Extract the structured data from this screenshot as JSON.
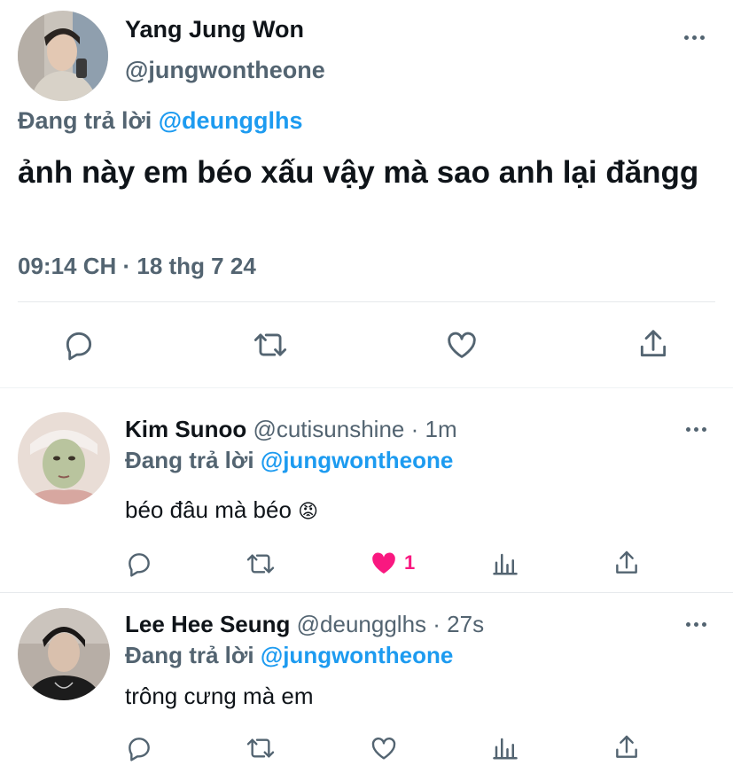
{
  "main_tweet": {
    "author_name": "Yang Jung Won",
    "author_handle": "@jungwontheone",
    "reply_prefix": "Đang trả lời",
    "reply_to": "@deungglhs",
    "text": "ảnh này em béo xấu vậy mà sao anh lại đăngg",
    "timestamp": "09:14 CH · 18 thg 7 24",
    "actions": [
      "reply-icon",
      "retweet-icon",
      "like-icon",
      "share-icon"
    ]
  },
  "replies": [
    {
      "author_name": "Kim Sunoo",
      "author_handle": "@cutisunshine",
      "time": "· 1m",
      "reply_prefix": "Đang trả lời",
      "reply_to": "@jungwontheone",
      "text": "béo đâu mà béo",
      "emoji": "😡",
      "like_count": "1",
      "liked": true
    },
    {
      "author_name": "Lee Hee Seung",
      "author_handle": "@deungglhs",
      "time": "· 27s",
      "reply_prefix": "Đang trả lời",
      "reply_to": "@jungwontheone",
      "text": "trông cưng mà em",
      "like_count": "",
      "liked": false
    }
  ],
  "colors": {
    "accent": "#1d9bf0",
    "icon_gray": "#536471",
    "like_red": "#f91880"
  }
}
